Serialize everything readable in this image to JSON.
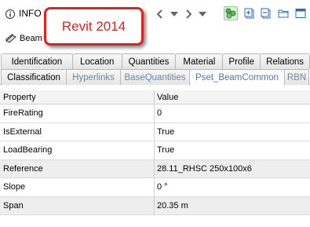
{
  "header": {
    "app_title": "INFO",
    "entity_label": "Beam",
    "callout_text": "Revit 2014"
  },
  "toolbar": {
    "icons": [
      "chevron-left-icon",
      "triangle-down-icon",
      "chevron-right-icon",
      "triangle-down-icon",
      "filter-icon",
      "tree-add-icon",
      "tree-remove-icon",
      "folder-icon",
      "window-icon"
    ]
  },
  "tabs": {
    "row1": [
      "Identification",
      "Location",
      "Quantities",
      "Material",
      "Profile",
      "Relations"
    ],
    "row2": [
      "Classification",
      "Hyperlinks",
      "BaseQuantities",
      "Pset_BeamCommon",
      "RBN"
    ],
    "selected": "Pset_BeamCommon"
  },
  "grid": {
    "headers": {
      "property": "Property",
      "value": "Value"
    },
    "rows": [
      {
        "property": "FireRating",
        "value": "0"
      },
      {
        "property": "IsExternal",
        "value": "True"
      },
      {
        "property": "LoadBearing",
        "value": "True"
      },
      {
        "property": "Reference",
        "value": "28.11_RHSC 250x100x6"
      },
      {
        "property": "Slope",
        "value": "0 °"
      },
      {
        "property": "Span",
        "value": "20.35 m"
      }
    ]
  },
  "colors": {
    "callout_border": "#e3211c",
    "selected_tab_text": "#5675a0",
    "dim_tab_text": "#6a86a6"
  }
}
